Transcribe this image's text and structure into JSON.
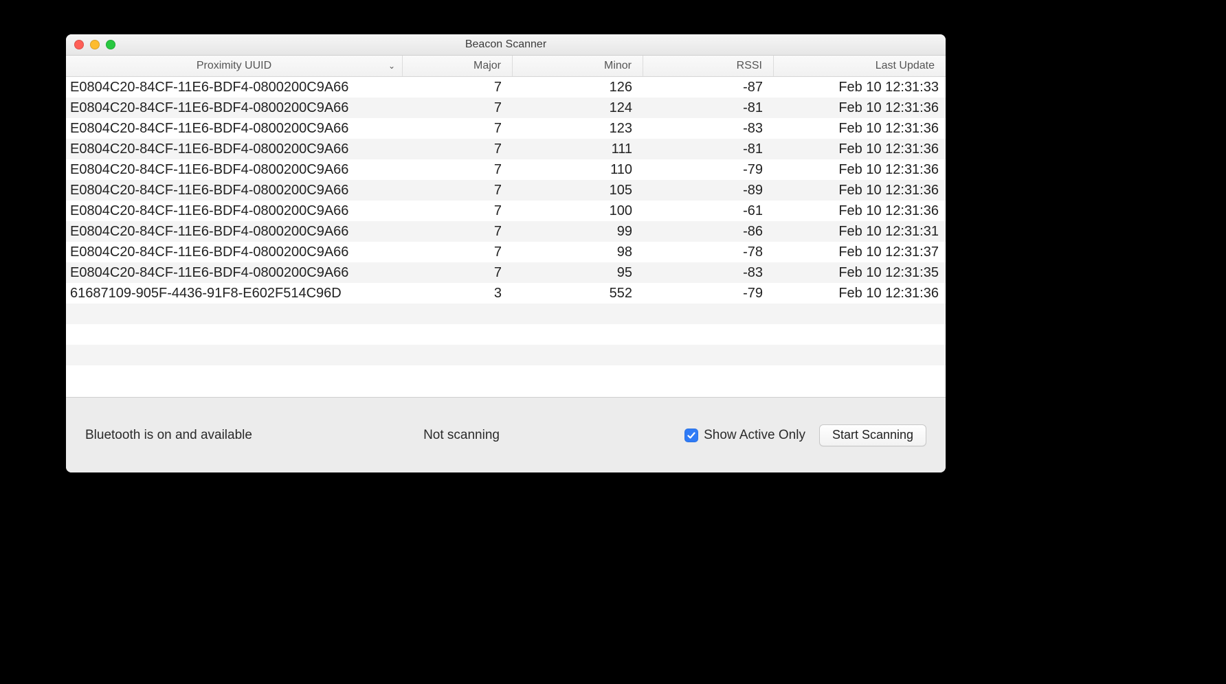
{
  "window": {
    "title": "Beacon Scanner"
  },
  "columns": {
    "uuid": "Proximity UUID",
    "major": "Major",
    "minor": "Minor",
    "rssi": "RSSI",
    "last": "Last Update"
  },
  "rows": [
    {
      "uuid": "E0804C20-84CF-11E6-BDF4-0800200C9A66",
      "major": "7",
      "minor": "126",
      "rssi": "-87",
      "last": "Feb 10 12:31:33"
    },
    {
      "uuid": "E0804C20-84CF-11E6-BDF4-0800200C9A66",
      "major": "7",
      "minor": "124",
      "rssi": "-81",
      "last": "Feb 10 12:31:36"
    },
    {
      "uuid": "E0804C20-84CF-11E6-BDF4-0800200C9A66",
      "major": "7",
      "minor": "123",
      "rssi": "-83",
      "last": "Feb 10 12:31:36"
    },
    {
      "uuid": "E0804C20-84CF-11E6-BDF4-0800200C9A66",
      "major": "7",
      "minor": "111",
      "rssi": "-81",
      "last": "Feb 10 12:31:36"
    },
    {
      "uuid": "E0804C20-84CF-11E6-BDF4-0800200C9A66",
      "major": "7",
      "minor": "110",
      "rssi": "-79",
      "last": "Feb 10 12:31:36"
    },
    {
      "uuid": "E0804C20-84CF-11E6-BDF4-0800200C9A66",
      "major": "7",
      "minor": "105",
      "rssi": "-89",
      "last": "Feb 10 12:31:36"
    },
    {
      "uuid": "E0804C20-84CF-11E6-BDF4-0800200C9A66",
      "major": "7",
      "minor": "100",
      "rssi": "-61",
      "last": "Feb 10 12:31:36"
    },
    {
      "uuid": "E0804C20-84CF-11E6-BDF4-0800200C9A66",
      "major": "7",
      "minor": "99",
      "rssi": "-86",
      "last": "Feb 10 12:31:31"
    },
    {
      "uuid": "E0804C20-84CF-11E6-BDF4-0800200C9A66",
      "major": "7",
      "minor": "98",
      "rssi": "-78",
      "last": "Feb 10 12:31:37"
    },
    {
      "uuid": "E0804C20-84CF-11E6-BDF4-0800200C9A66",
      "major": "7",
      "minor": "95",
      "rssi": "-83",
      "last": "Feb 10 12:31:35"
    },
    {
      "uuid": "61687109-905F-4436-91F8-E602F514C96D",
      "major": "3",
      "minor": "552",
      "rssi": "-79",
      "last": "Feb 10 12:31:36"
    }
  ],
  "footer": {
    "bluetooth_status": "Bluetooth is on and available",
    "scan_status": "Not scanning",
    "show_active_label": "Show Active Only",
    "show_active_checked": true,
    "scan_button": "Start Scanning"
  }
}
